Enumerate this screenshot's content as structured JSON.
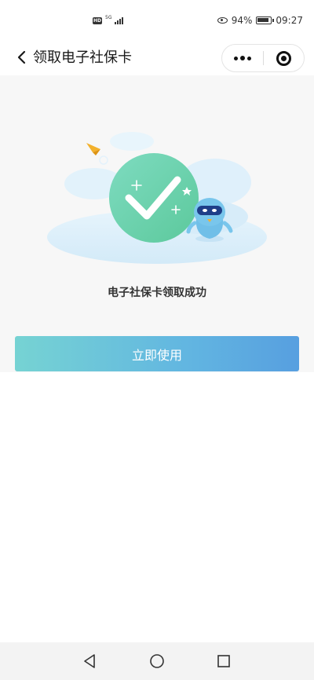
{
  "status_bar": {
    "network_badge": "HD",
    "network_type": "5G",
    "battery_percent": "94%",
    "time": "09:27"
  },
  "header": {
    "back_icon": "chevron-left-icon",
    "title": "领取电子社保卡",
    "more_icon": "more-dots-icon",
    "close_icon": "target-circle-icon"
  },
  "main": {
    "illustration_icon": "success-checkmark-illustration",
    "success_message": "电子社保卡领取成功",
    "use_button_label": "立即使用"
  },
  "colors": {
    "button_gradient_start": "#76d3d3",
    "button_gradient_end": "#579fe0",
    "check_circle": "#6ed3a8",
    "content_background": "#f7f7f7"
  },
  "system_nav": {
    "back_icon": "triangle-back-icon",
    "home_icon": "circle-home-icon",
    "recent_icon": "square-recent-icon"
  }
}
